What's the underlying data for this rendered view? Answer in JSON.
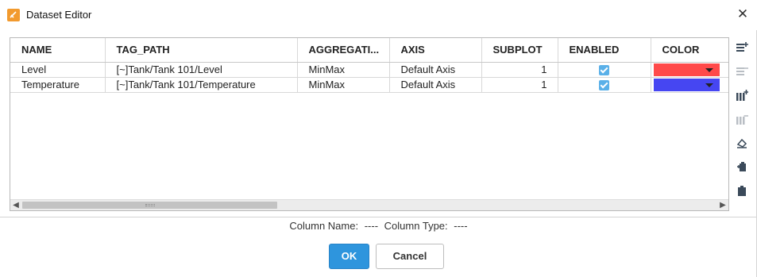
{
  "window": {
    "title": "Dataset Editor",
    "close_glyph": "✕"
  },
  "grid": {
    "columns": [
      {
        "label": "NAME"
      },
      {
        "label": "TAG_PATH"
      },
      {
        "label": "AGGREGATI..."
      },
      {
        "label": "AXIS"
      },
      {
        "label": "SUBPLOT"
      },
      {
        "label": "ENABLED"
      },
      {
        "label": "COLOR"
      }
    ],
    "rows": [
      {
        "name": "Level",
        "tag_path": "[~]Tank/Tank 101/Level",
        "aggregation": "MinMax",
        "axis": "Default Axis",
        "subplot": "1",
        "enabled": true,
        "color": "#ff4a4a"
      },
      {
        "name": "Temperature",
        "tag_path": "[~]Tank/Tank 101/Temperature",
        "aggregation": "MinMax",
        "axis": "Default Axis",
        "subplot": "1",
        "enabled": true,
        "color": "#4646f2"
      }
    ]
  },
  "toolbar": {
    "icons": [
      "add-row-icon",
      "delete-row-icon",
      "add-column-icon",
      "delete-column-icon",
      "eraser-icon",
      "paste-icon",
      "clipboard-icon"
    ]
  },
  "status": {
    "column_name_label": "Column Name:",
    "column_name_value": "----",
    "column_type_label": "Column Type:",
    "column_type_value": "----"
  },
  "buttons": {
    "ok_label": "OK",
    "cancel_label": "Cancel"
  },
  "colors": {
    "accent": "#2e95dd",
    "app_icon": "#f29a2e",
    "checkbox": "#5ab0e8"
  }
}
